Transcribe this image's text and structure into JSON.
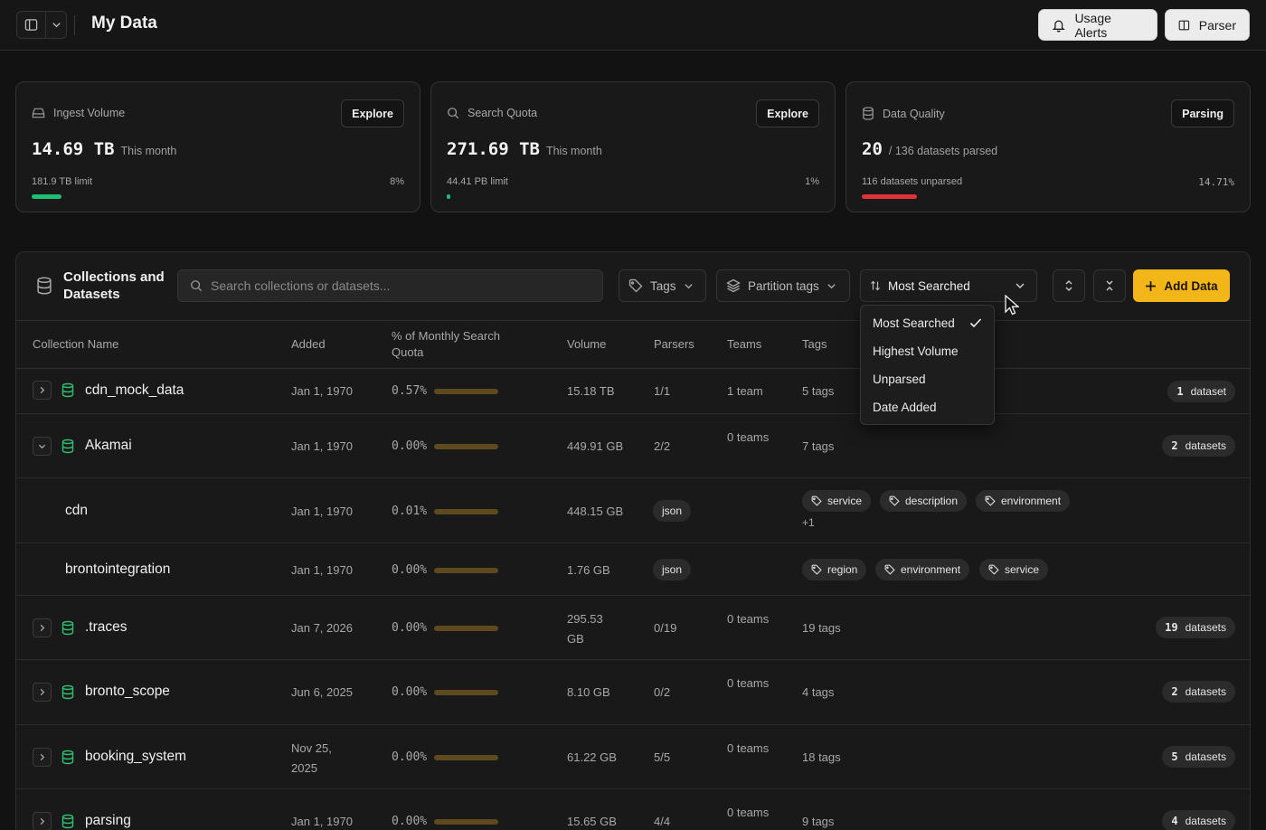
{
  "header": {
    "title": "My Data",
    "usage_alerts_label": "Usage Alerts",
    "parser_label": "Parser"
  },
  "cards": [
    {
      "label": "Ingest Volume",
      "button": "Explore",
      "value": "14.69 TB",
      "sub": "This month",
      "limit": "181.9 TB limit",
      "percent": "8%",
      "progress": 0.08,
      "bar_color": "#1fbf75",
      "icon": "drive-icon"
    },
    {
      "label": "Search Quota",
      "button": "Explore",
      "value": "271.69 TB",
      "sub": "This month",
      "limit": "44.41 PB limit",
      "percent": "1%",
      "progress": 0.01,
      "bar_color": "#1fbf75",
      "icon": "search-icon"
    },
    {
      "label": "Data Quality",
      "button": "Parsing",
      "value": "20",
      "sub": "/ 136 datasets parsed",
      "limit": "116 datasets unparsed",
      "percent": "14.71%",
      "progress": 0.1471,
      "bar_color": "#e0323a",
      "icon": "database-icon"
    }
  ],
  "panel": {
    "title": "Collections and Datasets",
    "search_placeholder": "Search collections or datasets...",
    "tags_filter": "Tags",
    "partition_filter": "Partition tags",
    "sort_selected": "Most Searched",
    "add_label": "Add Data"
  },
  "columns": [
    "Collection Name",
    "Added",
    "% of Monthly Search Quota",
    "Volume",
    "Parsers",
    "Teams",
    "Tags"
  ],
  "sort_options": [
    "Most Searched",
    "Highest Volume",
    "Unparsed",
    "Date Added"
  ],
  "rows": [
    {
      "name": "cdn_mock_data",
      "added": "Jan 1, 1970",
      "pct": "0.57%",
      "volume": "15.18 TB",
      "parsers": "1/1",
      "teams": "1 team",
      "tags": "5 tags",
      "count": "1",
      "count_label": "dataset"
    },
    {
      "name": "Akamai",
      "added": "Jan 1, 1970",
      "pct": "0.00%",
      "volume": "449.91 GB",
      "parsers": "2/2",
      "teams": "0 teams",
      "tags": "7 tags",
      "count": "2",
      "count_label": "datasets"
    },
    {
      "name": "cdn",
      "added": "Jan 1, 1970",
      "pct": "0.01%",
      "volume": "448.15 GB",
      "parser": "json",
      "tag_pills": [
        "service",
        "description",
        "environment"
      ],
      "more": "+1"
    },
    {
      "name": "brontointegration",
      "added": "Jan 1, 1970",
      "pct": "0.00%",
      "volume": "1.76 GB",
      "parser": "json",
      "tag_pills": [
        "region",
        "environment",
        "service"
      ]
    },
    {
      "name": ".traces",
      "added": "Jan 7, 2026",
      "pct": "0.00%",
      "volume": "295.53 GB",
      "parsers": "0/19",
      "teams": "0 teams",
      "tags": "19 tags",
      "count": "19",
      "count_label": "datasets"
    },
    {
      "name": "bronto_scope",
      "added": "Jun 6, 2025",
      "pct": "0.00%",
      "volume": "8.10 GB",
      "parsers": "0/2",
      "teams": "0 teams",
      "tags": "4 tags",
      "count": "2",
      "count_label": "datasets"
    },
    {
      "name": "booking_system",
      "added": "Nov 25, 2025",
      "pct": "0.00%",
      "volume": "61.22 GB",
      "parsers": "5/5",
      "teams": "0 teams",
      "tags": "18 tags",
      "count": "5",
      "count_label": "datasets"
    },
    {
      "name": "parsing",
      "added": "Jan 1, 1970",
      "pct": "0.00%",
      "volume": "15.65 GB",
      "parsers": "4/4",
      "teams": "0 teams",
      "tags": "9 tags",
      "count": "4",
      "count_label": "datasets"
    }
  ]
}
